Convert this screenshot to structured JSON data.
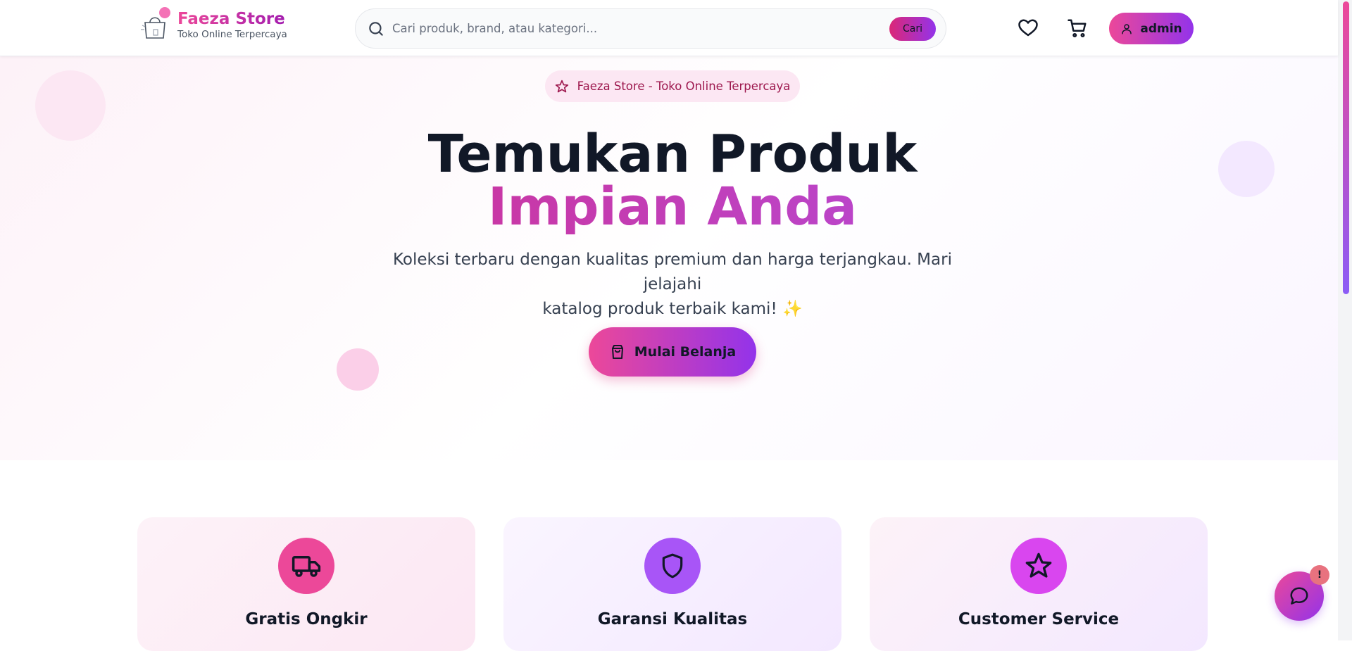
{
  "brand": {
    "name": "Faeza Store",
    "tagline": "Toko Online Terpercaya"
  },
  "search": {
    "placeholder": "Cari produk, brand, atau kategori...",
    "button_label": "Cari"
  },
  "header": {
    "user_label": "admin"
  },
  "hero": {
    "badge": "Faeza Store - Toko Online Terpercaya",
    "title_line1": "Temukan Produk",
    "title_line2": "Impian Anda",
    "subtitle_line1": "Koleksi terbaru dengan kualitas premium dan harga terjangkau. Mari jelajahi",
    "subtitle_line2": "katalog produk terbaik kami! ✨",
    "cta_label": "Mulai Belanja"
  },
  "features": [
    {
      "title": "Gratis Ongkir",
      "icon": "truck-icon",
      "color": "#ec4899"
    },
    {
      "title": "Garansi Kualitas",
      "icon": "shield-icon",
      "color": "#a855f7"
    },
    {
      "title": "Customer Service",
      "icon": "star-icon",
      "color": "#d946ef"
    }
  ],
  "chat": {
    "badge": "!"
  },
  "colors": {
    "accent_pink": "#ec4899",
    "accent_purple": "#9333ea",
    "text_dark": "#111827"
  }
}
